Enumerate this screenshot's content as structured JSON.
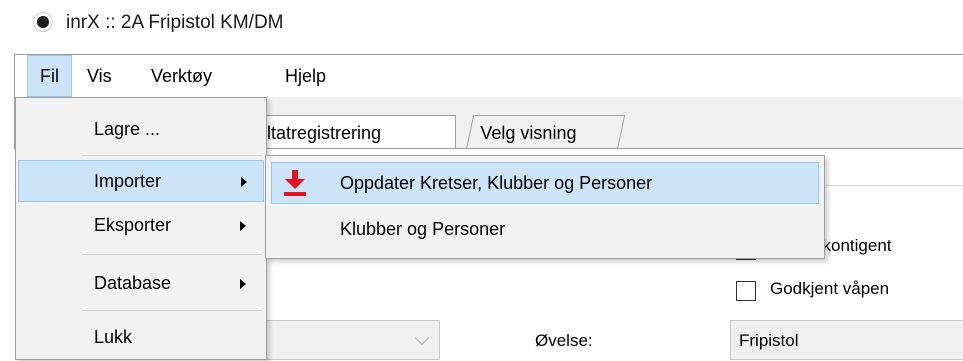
{
  "window": {
    "title": "inrX :: 2A Fripistol KM/DM"
  },
  "menubar": {
    "items": [
      {
        "label": "Fil"
      },
      {
        "label": "Vis"
      },
      {
        "label": "Verktøy"
      },
      {
        "label": "Hjelp"
      }
    ]
  },
  "tabs": [
    {
      "label": "ltatregistrering"
    },
    {
      "label": "Velg visning"
    }
  ],
  "file_menu": {
    "items": [
      {
        "label": "Lagre ..."
      },
      {
        "label": "Importer"
      },
      {
        "label": "Eksporter"
      },
      {
        "label": "Database"
      },
      {
        "label": "Lukk"
      }
    ]
  },
  "import_submenu": {
    "items": [
      {
        "label": "Oppdater Kretser, Klubber og Personer",
        "icon": "download-arrow-icon"
      },
      {
        "label": "Klubber og Personer"
      }
    ]
  },
  "form": {
    "checkbox1_label": "t startkontigent",
    "checkbox2_label": "Godkjent våpen",
    "ovelse_label": "Øvelse:",
    "ovelse_value": "Fripistol"
  },
  "colors": {
    "menu_highlight": "#cce4f7",
    "menu_highlight_border": "#99c8f0",
    "import_icon_red": "#e81123"
  }
}
